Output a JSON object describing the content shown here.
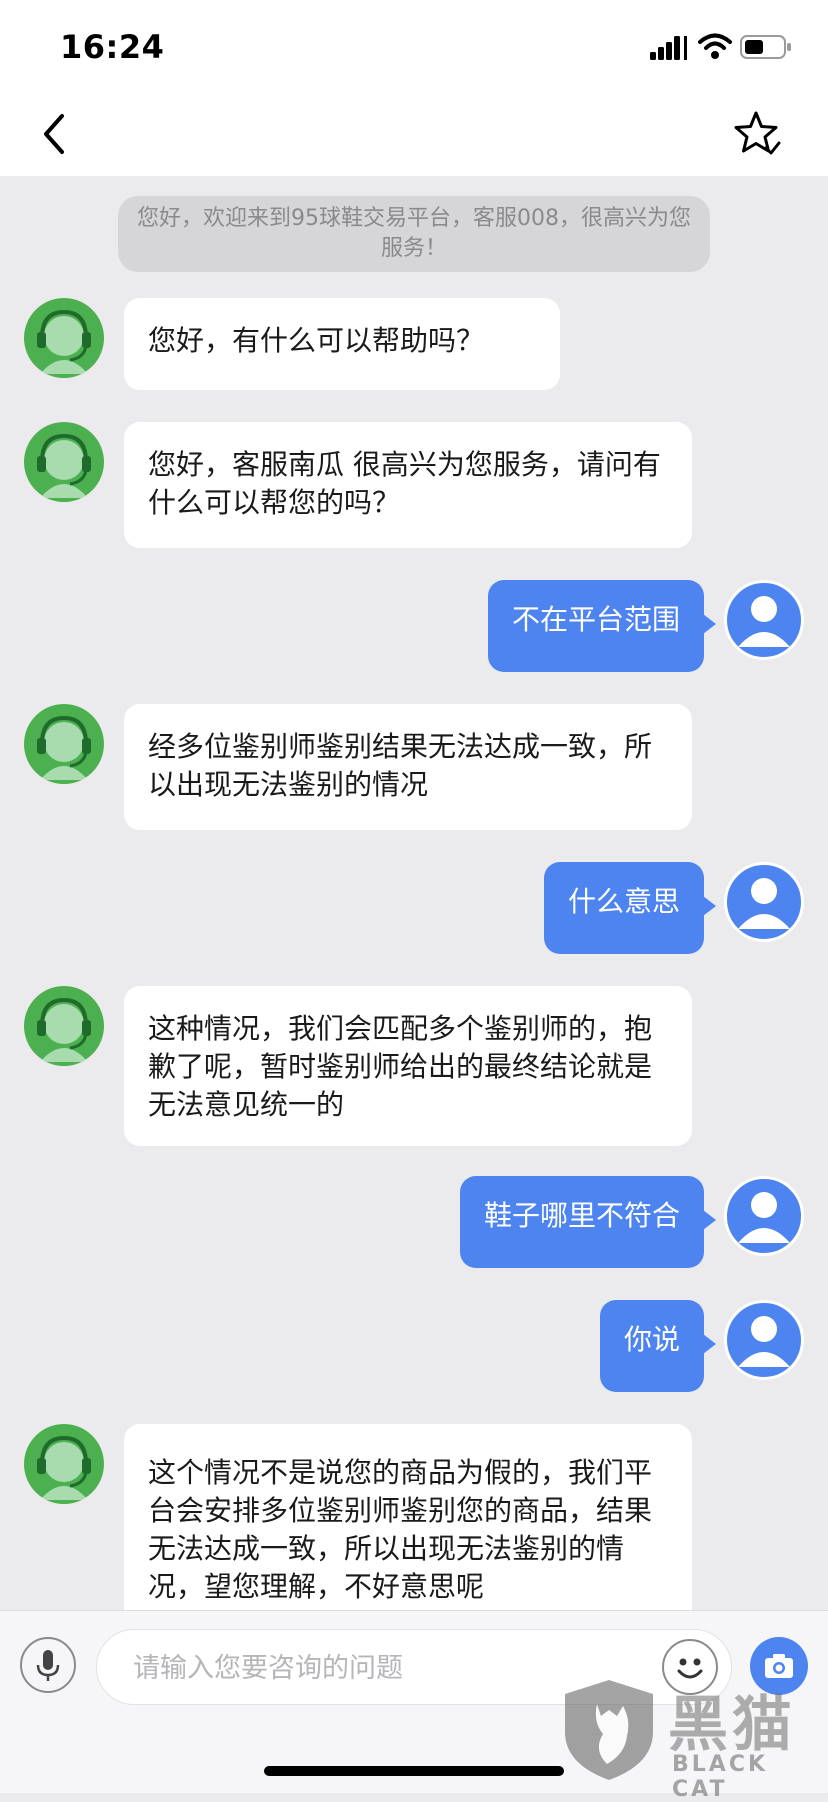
{
  "status_bar": {
    "time": "16:24"
  },
  "nav": {
    "back_icon": "chevron-left-icon",
    "favorite_icon": "star-outline-icon"
  },
  "colors": {
    "user_bubble": "#4d84f0",
    "agent_avatar": "#4caf50",
    "chat_background": "#ebebed"
  },
  "chat": {
    "system_notice": "您好，欢迎来到95球鞋交易平台，客服008，很高兴为您服务！",
    "messages": [
      {
        "from": "agent",
        "text": "您好，有什么可以帮助吗？"
      },
      {
        "from": "agent",
        "text": "您好，客服南瓜 很高兴为您服务，请问有什么可以帮您的吗？"
      },
      {
        "from": "user",
        "text": "不在平台范围"
      },
      {
        "from": "agent",
        "text": "经多位鉴别师鉴别结果无法达成一致，所以出现无法鉴别的情况"
      },
      {
        "from": "user",
        "text": "什么意思"
      },
      {
        "from": "agent",
        "text": "这种情况，我们会匹配多个鉴别师的，抱歉了呢，暂时鉴别师给出的最终结论就是无法意见统一的"
      },
      {
        "from": "user",
        "text": "鞋子哪里不符合"
      },
      {
        "from": "user",
        "text": "你说"
      },
      {
        "from": "agent",
        "text": "这个情况不是说您的商品为假的，我们平台会安排多位鉴别师鉴别您的商品，结果无法达成一致，所以出现无法鉴别的情况，望您理解，不好意思呢"
      }
    ]
  },
  "input": {
    "placeholder": "请输入您要咨询的问题"
  },
  "watermark": {
    "cn": "黑猫",
    "en": "BLACK CAT"
  }
}
